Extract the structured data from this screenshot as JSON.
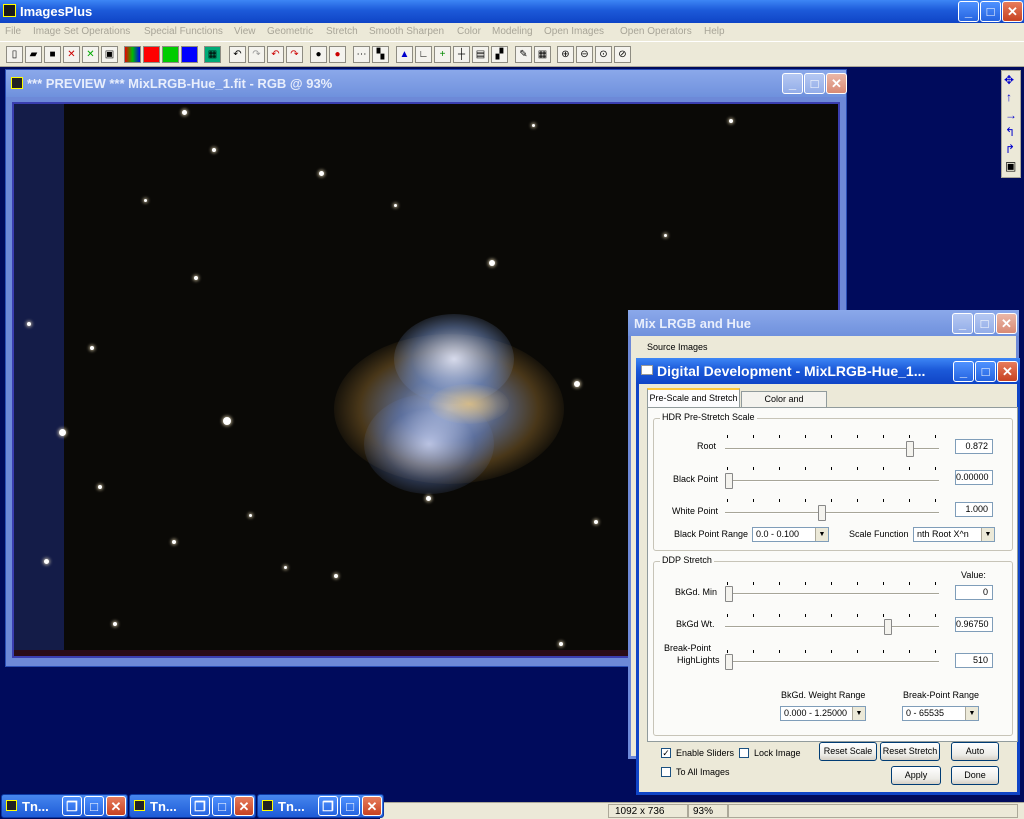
{
  "app": {
    "title": "ImagesPlus"
  },
  "menu": [
    "File",
    "Image Set Operations",
    "Special Functions",
    "View",
    "Geometric",
    "Stretch",
    "Smooth Sharpen",
    "Color",
    "Modeling",
    "Open Images",
    "Open Operators",
    "Help"
  ],
  "preview": {
    "title": "*** PREVIEW *** MixLRGB-Hue_1.fit - RGB @ 93%"
  },
  "mix": {
    "title": "Mix LRGB and Hue",
    "source_label": "Source Images"
  },
  "dd": {
    "title": "Digital Development - MixLRGB-Hue_1...",
    "tabs": [
      "Pre-Scale and Stretch",
      "Color and Sharpness"
    ],
    "hdr": {
      "caption": "HDR Pre-Stretch Scale",
      "root_label": "Root",
      "root_value": "0.872",
      "root_pos": 0.88,
      "black_label": "Black Point",
      "black_value": "0.00000",
      "black_pos": 0.0,
      "white_label": "White Point",
      "white_value": "1.000",
      "white_pos": 0.45,
      "bpr_label": "Black Point Range",
      "bpr_value": "0.0 - 0.100",
      "sf_label": "Scale Function",
      "sf_value": "nth Root X^n"
    },
    "ddp": {
      "caption": "DDP Stretch",
      "value_header": "Value:",
      "bkmin_label": "BkGd. Min",
      "bkmin_value": "0",
      "bkmin_pos": 0.0,
      "bkwt_label": "BkGd Wt.",
      "bkwt_value": "0.96750",
      "bkwt_pos": 0.77,
      "bp_label1": "Break-Point",
      "bp_label2": "HighLights",
      "bp_value": "510",
      "bp_pos": 0.0,
      "wr_label": "BkGd. Weight Range",
      "wr_value": "0.000 - 1.25000",
      "bpr_label": "Break-Point Range",
      "bpr_value": "0 - 65535"
    },
    "enable_sliders": "Enable Sliders",
    "lock_image": "Lock Image",
    "to_all_images": "To All Images",
    "reset_scale": "Reset Scale",
    "reset_stretch": "Reset Stretch",
    "auto": "Auto",
    "apply": "Apply",
    "done": "Done"
  },
  "status": {
    "dims": "1092 x 736",
    "zoom": "93%"
  },
  "taskbar": [
    {
      "label": "Tn..."
    },
    {
      "label": "Tn..."
    },
    {
      "label": "Tn..."
    }
  ],
  "side_tools": [
    "move-icon",
    "up-arrow-icon",
    "right-arrow-icon",
    "rotate-left-icon",
    "rotate-right-icon",
    "frame-icon"
  ]
}
